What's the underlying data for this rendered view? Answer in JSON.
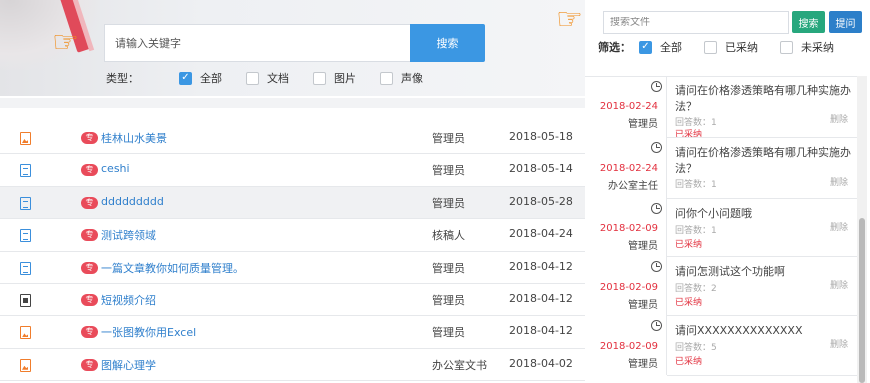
{
  "left_search": {
    "placeholder": "请输入关键字",
    "button": "搜索"
  },
  "type_filter": {
    "label": "类型：",
    "options": [
      {
        "label": "全部",
        "checked": true
      },
      {
        "label": "文档",
        "checked": false
      },
      {
        "label": "图片",
        "checked": false
      },
      {
        "label": "声像",
        "checked": false
      }
    ]
  },
  "badge_text": "专",
  "documents": [
    {
      "icon": "image-file-icon",
      "title": "桂林山水美景",
      "author": "管理员",
      "date": "2018-05-18"
    },
    {
      "icon": "document-file-icon",
      "title": "ceshi",
      "author": "管理员",
      "date": "2018-05-14"
    },
    {
      "icon": "document-file-icon",
      "title": "ddddddddd",
      "author": "管理员",
      "date": "2018-05-28"
    },
    {
      "icon": "document-file-icon",
      "title": "测试跨领域",
      "author": "核稿人",
      "date": "2018-04-24"
    },
    {
      "icon": "document-file-icon",
      "title": "一篇文章教你如何质量管理。",
      "author": "管理员",
      "date": "2018-04-12"
    },
    {
      "icon": "video-file-icon",
      "title": "短视频介绍",
      "author": "管理员",
      "date": "2018-04-12"
    },
    {
      "icon": "image-file-icon",
      "title": "一张图教你用Excel",
      "author": "管理员",
      "date": "2018-04-12"
    },
    {
      "icon": "image-file-icon",
      "title": "图解心理学",
      "author": "办公室文书",
      "date": "2018-04-02"
    }
  ],
  "right_search": {
    "placeholder": "搜索文件",
    "search_button": "搜索",
    "ask_button": "提问"
  },
  "status_filter": {
    "label": "筛选：",
    "options": [
      {
        "label": "全部",
        "checked": true
      },
      {
        "label": "已采纳",
        "checked": false
      },
      {
        "label": "未采纳",
        "checked": false
      }
    ]
  },
  "questions": [
    {
      "title": "请问在价格渗透策略有哪几种实施办法？",
      "date": "2018-02-24",
      "author": "管理员",
      "answer_count": "回答数：1",
      "delete": "删除",
      "status": "已采纳"
    },
    {
      "title": "请问在价格渗透策略有哪几种实施办法？",
      "date": "2018-02-24",
      "author": "办公室主任",
      "answer_count": "回答数：1",
      "delete": "删除",
      "status": ""
    },
    {
      "title": "问你个小问题哦",
      "date": "2018-02-09",
      "author": "管理员",
      "answer_count": "回答数：1",
      "delete": "删除",
      "status": "已采纳"
    },
    {
      "title": "请问怎测试这个功能啊",
      "date": "2018-02-09",
      "author": "管理员",
      "answer_count": "回答数：2",
      "delete": "删除",
      "status": "已采纳"
    },
    {
      "title": "请问XXXXXXXXXXXXXX",
      "date": "2018-02-09",
      "author": "管理员",
      "answer_count": "回答数：5",
      "delete": "删除",
      "status": "已采纳"
    }
  ],
  "colors": {
    "primary_blue": "#3b97e3",
    "link_blue": "#2f7fcc",
    "accent_red": "#e2303e",
    "green_button": "#27a77d",
    "hand_orange": "#f08c1a"
  }
}
